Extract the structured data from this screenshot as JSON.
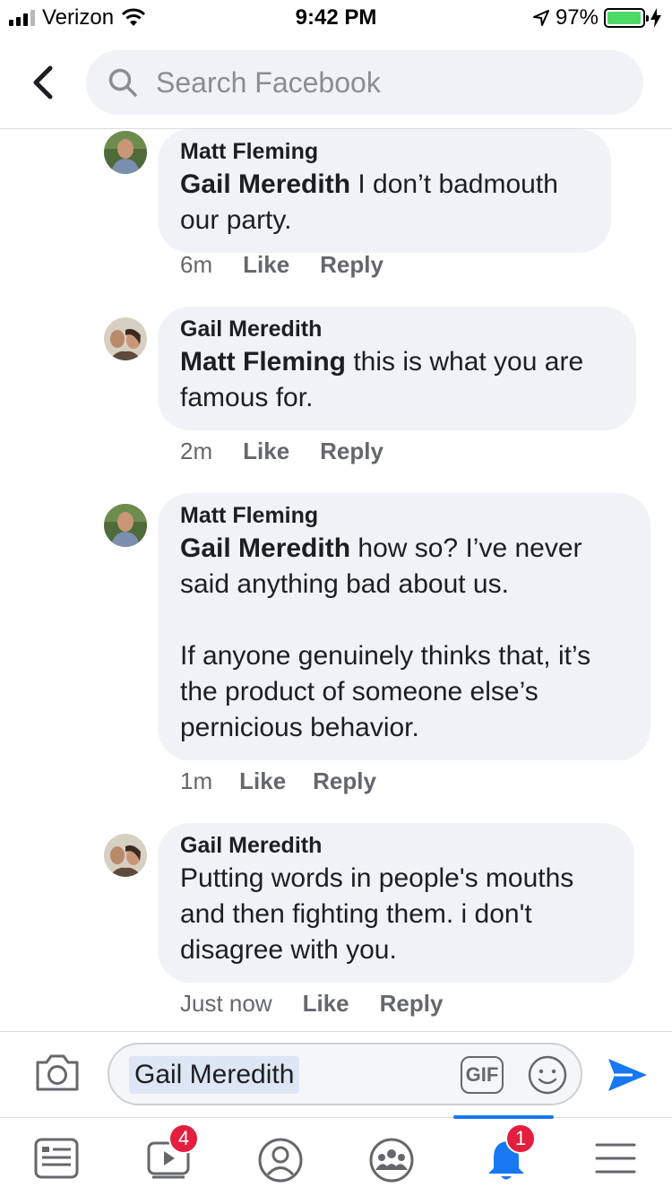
{
  "status_bar": {
    "carrier": "Verizon",
    "time": "9:42 PM",
    "battery_percent": "97%",
    "signal_bars": 4,
    "signal_bars_filled": 3
  },
  "header": {
    "search_placeholder": "Search Facebook",
    "back_icon": "chevron-left-icon",
    "search_icon": "search-icon"
  },
  "comments": [
    {
      "author": "Matt Fleming",
      "mention": "Gail Meredith",
      "text": " I don’t badmouth our party.",
      "time": "6m",
      "like_label": "Like",
      "reply_label": "Reply"
    },
    {
      "author": "Gail Meredith",
      "mention": "Matt Fleming",
      "text": " this is what you are famous for.",
      "time": "2m",
      "like_label": "Like",
      "reply_label": "Reply"
    },
    {
      "author": "Matt Fleming",
      "mention": "Gail Meredith",
      "text": " how so? I’ve never said anything bad about us.\n\nIf anyone genuinely thinks that, it’s the product of someone else’s pernicious behavior.",
      "time": "1m",
      "like_label": "Like",
      "reply_label": "Reply"
    },
    {
      "author": "Gail Meredith",
      "mention": "",
      "text": "Putting words in people's mouths and then fighting them. i don't disagree with you.",
      "time": "Just now",
      "like_label": "Like",
      "reply_label": "Reply"
    }
  ],
  "composer": {
    "mention_text": "Gail Meredith",
    "gif_label": "GIF",
    "camera_icon": "camera-icon",
    "emoji_icon": "smiley-icon",
    "send_icon": "send-icon"
  },
  "tabbar": {
    "active_tab": "notifications",
    "tabs": [
      {
        "name": "news-feed",
        "icon": "news-feed-icon",
        "badge": ""
      },
      {
        "name": "watch",
        "icon": "watch-video-icon",
        "badge": "4"
      },
      {
        "name": "profile",
        "icon": "profile-icon",
        "badge": ""
      },
      {
        "name": "groups",
        "icon": "groups-icon",
        "badge": ""
      },
      {
        "name": "notifications",
        "icon": "bell-icon",
        "badge": "1"
      },
      {
        "name": "menu",
        "icon": "menu-icon",
        "badge": ""
      }
    ]
  },
  "colors": {
    "accent": "#1877f2",
    "bubble_bg": "#f0f2f5",
    "secondary_text": "#65676b",
    "badge_red": "#e41e3f",
    "battery_green": "#4cd964"
  }
}
